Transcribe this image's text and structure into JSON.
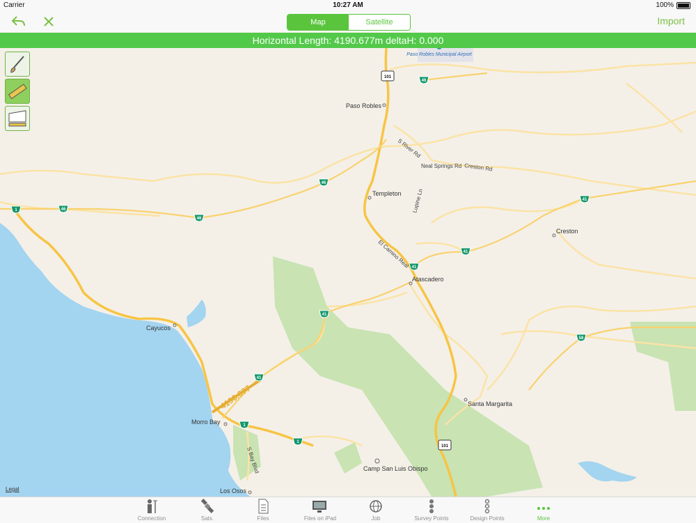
{
  "status_bar": {
    "carrier": "Carrier",
    "time": "10:27 AM",
    "battery": "100%"
  },
  "nav": {
    "back_icon": "undo-icon",
    "close_icon": "close-icon",
    "segments": [
      {
        "label": "Map",
        "selected": true
      },
      {
        "label": "Satellite",
        "selected": false
      }
    ],
    "import_label": "Import"
  },
  "info_bar": {
    "text": "Horizontal Length: 4190.677m deltaH: 0.000"
  },
  "tools": [
    {
      "icon": "brush-icon"
    },
    {
      "icon": "ruler-icon"
    },
    {
      "icon": "area-ruler-icon"
    }
  ],
  "map": {
    "measurement_label": "4190.677",
    "airport": "Paso Robles Municipal Airport",
    "places": {
      "paso_robles": "Paso Robles",
      "templeton": "Templeton",
      "creston": "Creston",
      "atascadero": "Atascadero",
      "cayucos": "Cayucos",
      "morro_bay": "Morro Bay",
      "santa_margarita": "Santa Margarita",
      "camp_san_luis_obispo": "Camp San Luis Obispo",
      "los_osos": "Los Osos"
    },
    "roads": {
      "s_river_rd": "S River Rd",
      "neal_springs_rd": "Neal Springs Rd",
      "creston_rd": "Creston Rd",
      "lupine_ln": "Lupine Ln",
      "el_camino_real": "El Camino Real",
      "s_bay_blvd": "S Bay Blvd"
    },
    "shields": {
      "us101": "101",
      "ca46": "46",
      "ca41": "41",
      "ca1": "1",
      "ca58": "58"
    },
    "legal": "Legal",
    "colors": {
      "water": "#a3d4f0",
      "land": "#f4f0e8",
      "park": "#c9e3b3",
      "highway": "#f7c444",
      "road": "#fbe3a5",
      "measure": "#e5ae33"
    }
  },
  "tabs": [
    {
      "label": "Connection",
      "icon": "surveyor-icon",
      "active": false
    },
    {
      "label": "Sats.",
      "icon": "satellite-icon",
      "active": false
    },
    {
      "label": "Files",
      "icon": "file-icon",
      "active": false
    },
    {
      "label": "Files on iPad",
      "icon": "monitor-icon",
      "active": false
    },
    {
      "label": "Job",
      "icon": "globe-icon",
      "active": false
    },
    {
      "label": "Survey Points",
      "icon": "points-icon",
      "active": false
    },
    {
      "label": "Design Points",
      "icon": "design-points-icon",
      "active": false
    },
    {
      "label": "More",
      "icon": "more-icon",
      "active": true
    }
  ]
}
